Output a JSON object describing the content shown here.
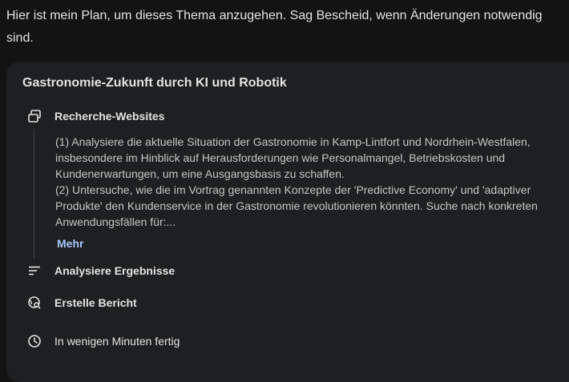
{
  "intro_text": "Hier ist mein Plan, um dieses Thema anzugehen. Sag Bescheid, wenn Änderungen notwendig sind.",
  "plan": {
    "title": "Gastronomie-Zukunft durch KI und Robotik",
    "steps": [
      {
        "label": "Recherche-Websites",
        "icon": "web-research-icon"
      },
      {
        "label": "Analysiere Ergebnisse",
        "icon": "lines-icon"
      },
      {
        "label": "Erstelle Bericht",
        "icon": "globe-search-icon"
      }
    ],
    "description": "(1) Analysiere die aktuelle Situation der Gastronomie in Kamp-Lintfort und Nordrhein-Westfalen, insbesondere im Hinblick auf Herausforderungen wie Personalmangel, Betriebskosten und Kundenerwartungen, um eine Ausgangsbasis zu schaffen.\n(2) Untersuche, wie die im Vortrag genannten Konzepte der 'Predictive Economy' und 'adaptiver Produkte' den Kundenservice in der Gastronomie revolutionieren könnten. Suche nach konkreten Anwendungsfällen für:...",
    "more_label": "Mehr",
    "duration": {
      "label": "In wenigen Minuten fertig",
      "icon": "clock-icon"
    }
  },
  "colors": {
    "background": "#131314",
    "card": "#1e1f20",
    "link": "#a8c7fa"
  }
}
